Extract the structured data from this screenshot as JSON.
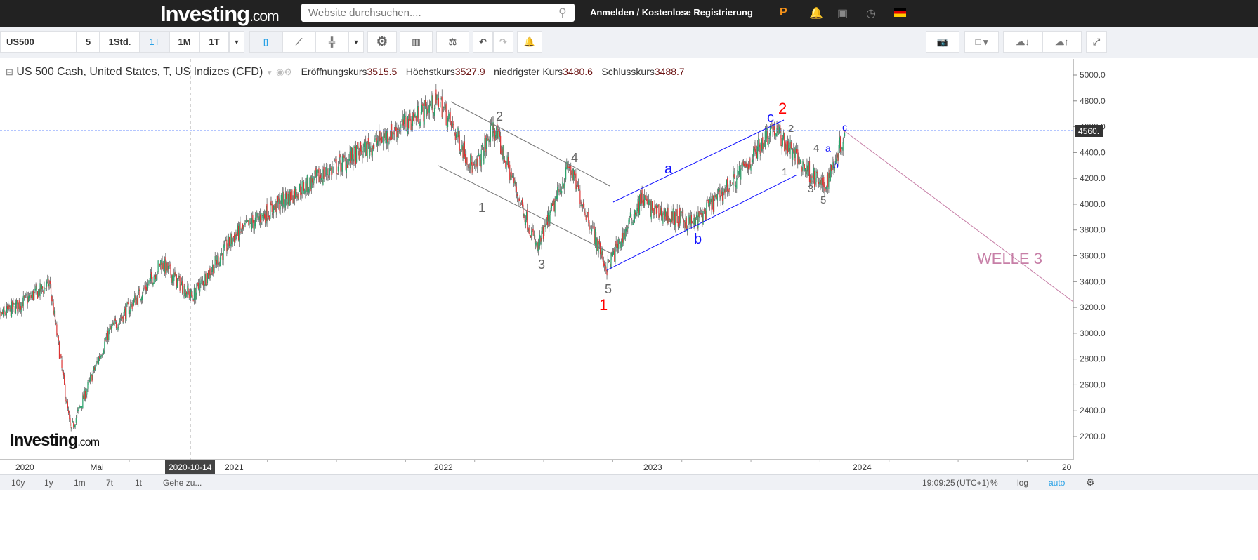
{
  "header": {
    "logo": "Investing",
    "logo_suffix": ".com",
    "search_placeholder": "Website durchsuchen....",
    "login": "Anmelden",
    "separator": "/",
    "register": "Kostenlose Registrierung"
  },
  "toolbar": {
    "symbol": "US500",
    "intervals": [
      "5",
      "1Std.",
      "1T",
      "1M",
      "1T"
    ],
    "active_interval": "1T"
  },
  "legend": {
    "title": "US 500 Cash, United States, T, US Indizes (CFD)",
    "open_label": "Eröffnungskurs",
    "open": "3515.5",
    "high_label": "Höchstkurs",
    "high": "3527.9",
    "low_label": "niedrigster Kurs",
    "low": "3480.6",
    "close_label": "Schlusskurs",
    "close": "3488.7"
  },
  "chart_data": {
    "type": "candlestick",
    "instrument": "US 500 Cash",
    "ylim": [
      2100,
      5100
    ],
    "y_ticks": [
      "5000.0",
      "4800.0",
      "4600.0",
      "4400.0",
      "4200.0",
      "4000.0",
      "3800.0",
      "3600.0",
      "3400.0",
      "3200.0",
      "3000.0",
      "2800.0",
      "2600.0",
      "2400.0",
      "2200.0"
    ],
    "current_price_label": "4560.",
    "current_price": 4560,
    "x_labels": [
      "2020",
      "Mai",
      "2021",
      "2022",
      "2023",
      "2024",
      "20"
    ],
    "crosshair_date": "2020-10-14",
    "approx_close_path": [
      [
        2019.85,
        3100
      ],
      [
        2020.0,
        3250
      ],
      [
        2020.12,
        3380
      ],
      [
        2020.22,
        2240
      ],
      [
        2020.4,
        3000
      ],
      [
        2020.6,
        3400
      ],
      [
        2020.65,
        3550
      ],
      [
        2020.8,
        3280
      ],
      [
        2021.0,
        3750
      ],
      [
        2021.3,
        4100
      ],
      [
        2021.5,
        4300
      ],
      [
        2021.7,
        4500
      ],
      [
        2021.98,
        4800
      ],
      [
        2022.15,
        4250
      ],
      [
        2022.24,
        4600
      ],
      [
        2022.45,
        3650
      ],
      [
        2022.6,
        4300
      ],
      [
        2022.78,
        3500
      ],
      [
        2022.95,
        4050
      ],
      [
        2023.0,
        3950
      ],
      [
        2023.2,
        3850
      ],
      [
        2023.45,
        4300
      ],
      [
        2023.57,
        4600
      ],
      [
        2023.72,
        4300
      ],
      [
        2023.82,
        4120
      ],
      [
        2023.92,
        4560
      ]
    ],
    "annotations": {
      "w2": "2",
      "w1": "1",
      "w3": "3",
      "w4": "4",
      "w5": "5",
      "big1": "1",
      "a": "a",
      "b": "b",
      "c": "c",
      "big2": "2",
      "s2": "2",
      "s1": "1",
      "s4": "4",
      "s3": "3",
      "s5": "5",
      "sa": "a",
      "sb": "b",
      "sc": "c",
      "welle": "WELLE 3"
    }
  },
  "watermark": {
    "text": "Investing",
    "suffix": ".com"
  },
  "footer": {
    "ranges": [
      "10y",
      "1y",
      "1m",
      "7t",
      "1t"
    ],
    "goto": "Gehe zu...",
    "time": "19:09:25",
    "tz": "(UTC+1)",
    "percent": "%",
    "log": "log",
    "auto": "auto"
  },
  "colors": {
    "up": "#26a269",
    "down": "#d33",
    "blue": "#1010ff",
    "red": "#ff0000",
    "pink": "#c77fa7"
  }
}
